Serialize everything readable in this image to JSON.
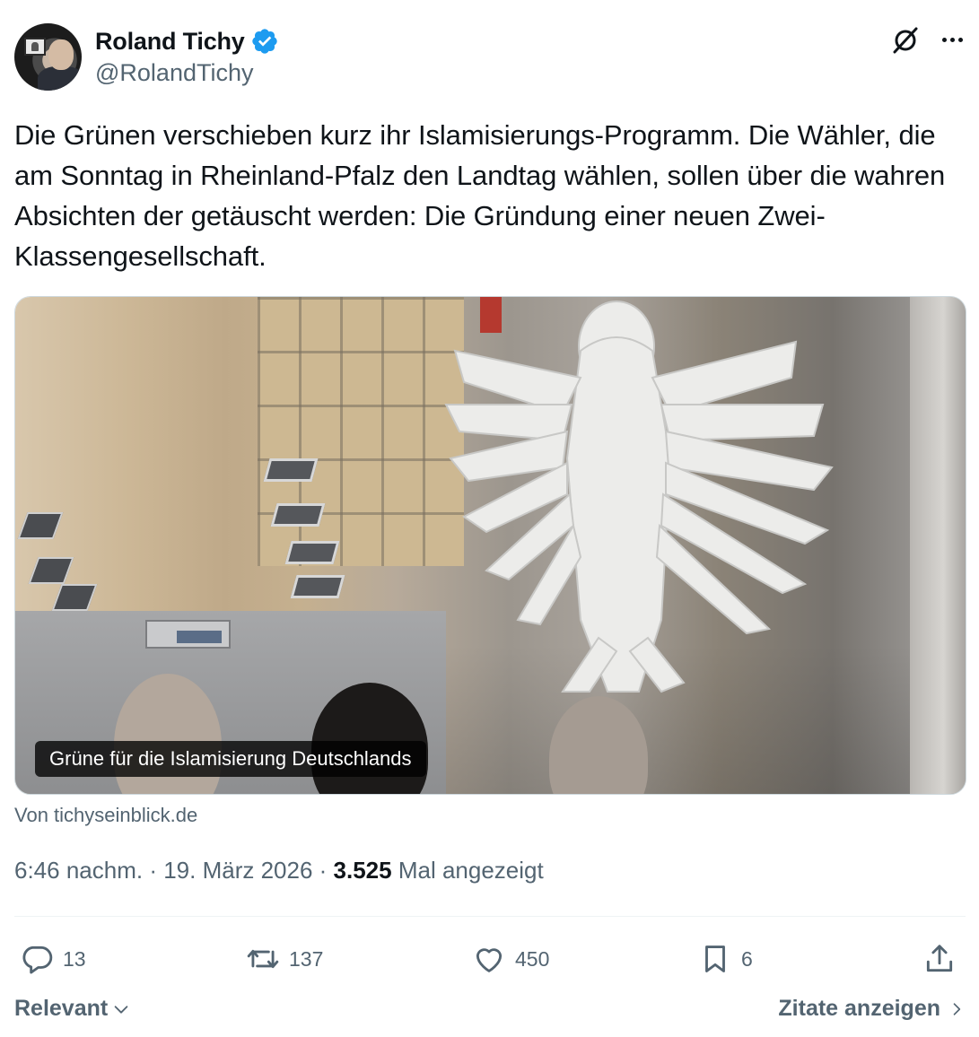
{
  "author": {
    "display_name": "Roland Tichy",
    "handle": "@RolandTichy",
    "verified": true
  },
  "tweet": {
    "text": "Die Grünen verschieben kurz ihr Islamisierungs-Programm. Die Wähler, die am Sonntag in Rheinland-Pfalz den Landtag wählen, sollen über die wahren Absichten der getäuscht werden: Die Gründung einer neuen Zwei-Klassengesellschaft."
  },
  "card": {
    "caption": "Grüne für die Islamisierung Deutschlands",
    "source": "Von tichyseinblick.de"
  },
  "meta": {
    "time": "6:46 nachm.",
    "separator1": " · ",
    "date": "19. März 2026",
    "separator2": " · ",
    "views_count": "3.525",
    "views_label": " Mal angezeigt"
  },
  "actions": {
    "replies": "13",
    "reposts": "137",
    "likes": "450",
    "bookmarks": "6"
  },
  "footer": {
    "sort_label": "Relevant",
    "quotes_label": "Zitate anzeigen"
  },
  "colors": {
    "verified_blue": "#1d9bf0",
    "secondary_text": "#536471",
    "primary_text": "#0f1419"
  },
  "icons": [
    "verified-badge-icon",
    "grok-icon",
    "more-icon",
    "reply-icon",
    "repost-icon",
    "like-icon",
    "bookmark-icon",
    "share-icon",
    "chevron-down-icon",
    "chevron-right-icon"
  ]
}
